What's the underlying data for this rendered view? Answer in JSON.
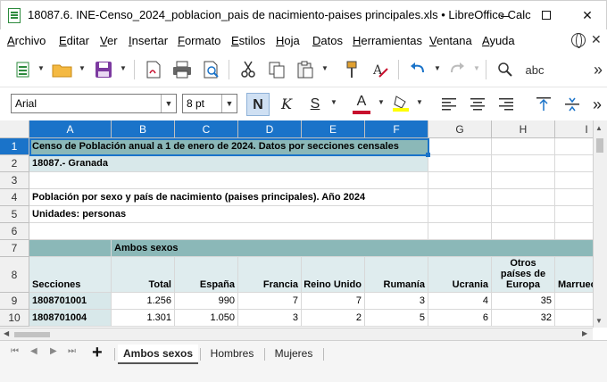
{
  "window": {
    "title": "18087.6. INE-Censo_2024_poblacion_pais de nacimiento-paises principales.xls • LibreOffice Calc",
    "minimize": "—",
    "close": "✕"
  },
  "menu": {
    "items": [
      "Archivo",
      "Editar",
      "Ver",
      "Insertar",
      "Formato",
      "Estilos",
      "Hoja",
      "Datos",
      "Herramientas",
      "Ventana",
      "Ayuda"
    ],
    "close": "✕"
  },
  "toolbar": {
    "font_name": "Arial",
    "font_size": "8 pt",
    "bold": "N",
    "italic": "K",
    "underline": "S",
    "font_color_letter": "A",
    "spellcheck": "abc",
    "more": "»",
    "colors": {
      "font_color": "#c8102e",
      "highlight": "#ffff00",
      "accent": "#1a73c9"
    }
  },
  "sheet": {
    "columns": [
      "A",
      "B",
      "C",
      "D",
      "E",
      "F",
      "G",
      "H",
      "I"
    ],
    "rows": [
      "1",
      "2",
      "3",
      "4",
      "5",
      "6",
      "7",
      "8",
      "9",
      "10"
    ],
    "cells": {
      "r1": "Censo de Población anual a 1 de enero de 2024. Datos por secciones censales",
      "r2": "18087.- Granada",
      "r4": "Población por sexo y  país de nacimiento (paises principales). Año 2024",
      "r5": "Unidades: personas",
      "r7b": "Ambos sexos",
      "r8": [
        "Secciones",
        "Total",
        "España",
        "Francia",
        "Reino Unido",
        "Rumanía",
        "Ucrania",
        "Otros países de Europa",
        "Marruecos"
      ],
      "r9": [
        "1808701001",
        "1.256",
        "990",
        "7",
        "7",
        "3",
        "4",
        "35"
      ],
      "r10": [
        "1808701004",
        "1.301",
        "1.050",
        "3",
        "2",
        "5",
        "6",
        "32"
      ]
    }
  },
  "tabs": {
    "add": "+",
    "items": [
      "Ambos sexos",
      "Hombres",
      "Mujeres"
    ],
    "active": "Ambos sexos"
  }
}
